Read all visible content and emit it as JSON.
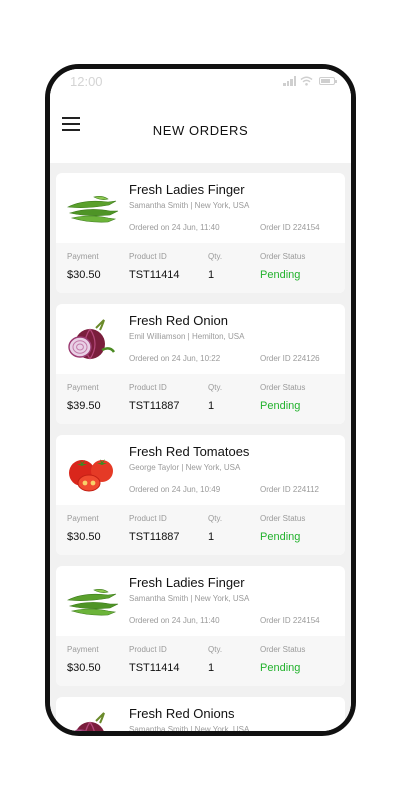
{
  "status_bar": {
    "time": "12:00"
  },
  "header": {
    "title": "NEW ORDERS"
  },
  "labels": {
    "payment": "Payment",
    "product_id": "Product ID",
    "qty": "Qty.",
    "order_status": "Order Status"
  },
  "orders": [
    {
      "product": "Fresh Ladies Finger",
      "customer": "Samantha Smith  |  New York, USA",
      "ordered_on": "Ordered on 24 Jun, 11:40",
      "order_id": "Order ID 224154",
      "payment": "$30.50",
      "product_id": "TST11414",
      "qty": "1",
      "status": "Pending",
      "icon": "okra-icon"
    },
    {
      "product": "Fresh Red Onion",
      "customer": "Emil Williamson  |  Hemilton, USA",
      "ordered_on": "Ordered on 24 Jun, 10:22",
      "order_id": "Order ID 224126",
      "payment": "$39.50",
      "product_id": "TST11887",
      "qty": "1",
      "status": "Pending",
      "icon": "onion-icon"
    },
    {
      "product": "Fresh Red Tomatoes",
      "customer": "George Taylor  |  New York, USA",
      "ordered_on": "Ordered on 24 Jun, 10:49",
      "order_id": "Order ID 224112",
      "payment": "$30.50",
      "product_id": "TST11887",
      "qty": "1",
      "status": "Pending",
      "icon": "tomato-icon"
    },
    {
      "product": "Fresh Ladies Finger",
      "customer": "Samantha Smith  |  New York, USA",
      "ordered_on": "Ordered on 24 Jun, 11:40",
      "order_id": "Order ID 224154",
      "payment": "$30.50",
      "product_id": "TST11414",
      "qty": "1",
      "status": "Pending",
      "icon": "okra-icon"
    },
    {
      "product": "Fresh Red Onions",
      "customer": "Samantha Smith  |  New York, USA",
      "ordered_on": "",
      "order_id": "",
      "payment": "",
      "product_id": "",
      "qty": "",
      "status": "",
      "icon": "onion-icon"
    }
  ],
  "colors": {
    "pending": "#22b22c",
    "background": "#f1f1f1"
  }
}
